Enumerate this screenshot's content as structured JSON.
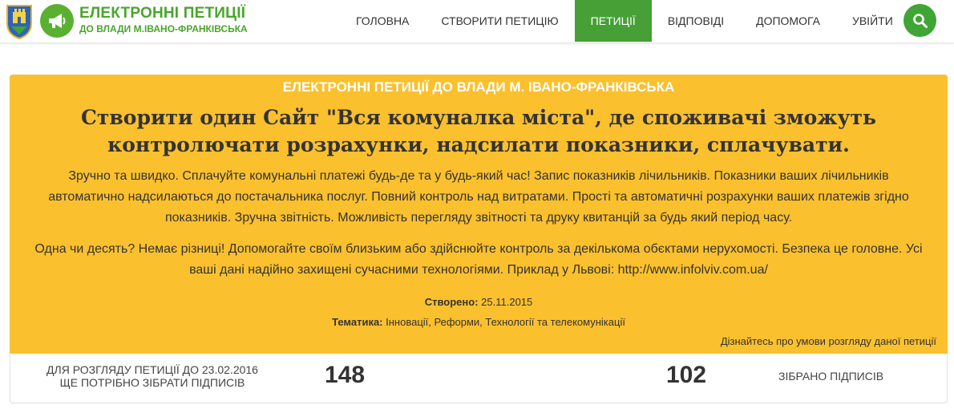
{
  "header": {
    "brand_title": "ЕЛЕКТРОННІ ПЕТИЦІЇ",
    "brand_subtitle": "ДО ВЛАДИ М.ІВАНО-ФРАНКІВСЬКА",
    "logo_icon": "coat-of-arms-icon",
    "megaphone_icon": "megaphone-icon",
    "search_icon": "search-icon",
    "accent_color": "#46a036"
  },
  "nav": {
    "items": [
      {
        "label": "Головна"
      },
      {
        "label": "Створити петицію"
      },
      {
        "label": "Петиції"
      },
      {
        "label": "Відповіді"
      },
      {
        "label": "Допомога"
      },
      {
        "label": "Увійти"
      }
    ],
    "active_index": 2
  },
  "petition": {
    "kicker": "ЕЛЕКТРОННІ ПЕТИЦІЇ ДО ВЛАДИ М. ІВАНО-ФРАНКІВСЬКА",
    "title": "Створити один Сайт \"Вся комуналка міста\", де споживачі зможуть контролючати розрахунки, надсилати показники, сплачувати.",
    "paragraph1": "Зручно та швидко. Сплачуйте комунальні платежі будь-де та у будь-який час! Запис показників лічильників. Показники ваших лічильників автоматично надсилаються до постачальника послуг. Повний контроль над витратами. Прості та автоматичні розрахунки ваших платежів згідно показників. Зручна звітність. Можливість перегляду звітності та друку квитанцій за будь який період часу.",
    "paragraph2": "Одна чи десять? Немає різниці! Допомогайте своїм близьким або здійснюйте контроль за декількома обєктами нерухомості. Безпека це головне. Усі ваші дані надійно захищені сучасними технологіями. Приклад у Львові: http://www.infolviv.com.ua/",
    "created_label": "Створено:",
    "created_value": "25.11.2015",
    "topic_label": "Тематика:",
    "topic_value": "Інновації, Реформи, Технології та телекомунікації",
    "terms_link": "Дізнайтесь про умови розгляду даної петиції",
    "card_color": "#fbc02d"
  },
  "signatures": {
    "need_text_line1": "ДЛЯ РОЗГЛЯДУ ПЕТИЦІЇ ДО 23.02.2016",
    "need_text_line2": "ЩЕ ПОТРІБНО ЗІБРАТИ ПІДПИСІВ",
    "needed": "148",
    "collected": "102",
    "collected_label": "ЗІБРАНО ПІДПИСІВ"
  }
}
